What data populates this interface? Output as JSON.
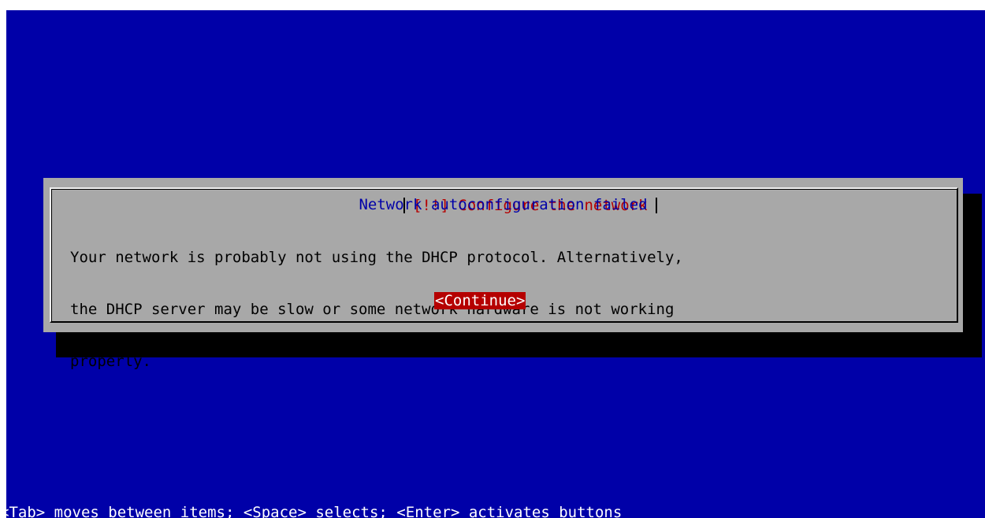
{
  "dialog": {
    "title": "[!!] Configure the network",
    "subtitle": "Network autoconfiguration failed",
    "message_lines": [
      "Your network is probably not using the DHCP protocol. Alternatively,",
      "the DHCP server may be slow or some network hardware is not working",
      "properly."
    ],
    "continue_label": "<Continue>"
  },
  "help_line": "<Tab> moves between items; <Space> selects; <Enter> activates buttons",
  "colors": {
    "background": "#0000a8",
    "dialog": "#a8a8a8",
    "title_text": "#b50000",
    "subtitle_text": "#0000a8",
    "button_bg": "#b50000",
    "button_text": "#ffffff",
    "shadow": "#000000"
  }
}
